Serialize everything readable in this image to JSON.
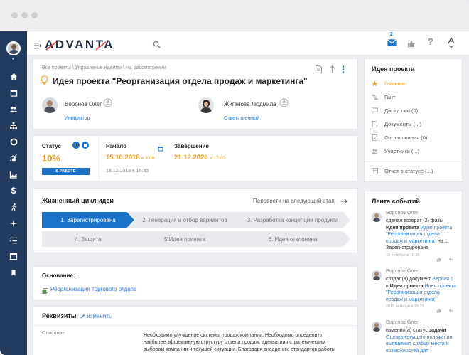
{
  "header": {
    "logo": "ADVANTA",
    "notifications_count": "2"
  },
  "breadcrumb": [
    "Все проекты",
    "Управление идеями",
    "На рассмотрении"
  ],
  "breadcrumb_sep": "\\",
  "page_title": "Идея проекта \"Реорганизация отдела продаж и маркетинга\"",
  "people": [
    {
      "name": "Воронов Олег",
      "role": "Инициатор"
    },
    {
      "name": "Жиганова Людмила",
      "role": "Ответственный"
    }
  ],
  "status": {
    "label": "Статус",
    "percent": "10%",
    "badge": "В РАБОТЕ",
    "start_label": "Начало",
    "start_date": "15.10.2018",
    "start_time": "в 8:00",
    "end_label": "Завершение",
    "end_date": "21.12.2020",
    "end_time": "в 17:00",
    "updated": "18.12.2018 в 15:35"
  },
  "lifecycle": {
    "title": "Жизненный цикл идеи",
    "next_action": "Перевести на следующий этап",
    "stages": [
      "1. Зарегистрирована",
      "2. Генерация и отбор вариантов",
      "3. Разработка концепции продукта",
      "4. Защита",
      "5.Идея принята",
      "6. Идея отклонена"
    ]
  },
  "basis": {
    "label": "Основание:",
    "link": "Реорганизация торгового отдела"
  },
  "requisites": {
    "title": "Реквизиты",
    "edit": "изменить",
    "desc_label": "Описание",
    "desc_lines": [
      "Необходимо улучшение системы продаж компании. Необходимо определить",
      "наиболее эффективную структуру отдела продаж, адекватная стратегическим",
      "выборам компании и текущей ситуации. Благодаря внедрению стандартов работы"
    ]
  },
  "sidebar": {
    "title": "Идея проекта",
    "items": [
      "Главная",
      "Гант",
      "Дискуссии (0)",
      "Документы (...)",
      "Согласования (0)",
      "Участники (...)"
    ],
    "report": "Отчет о статусе (...)"
  },
  "feed": {
    "title": "Лента событий",
    "events": [
      {
        "author": "Воронов Олег",
        "lines": [
          [
            {
              "t": "сделал возврат (2) фазы",
              "s": "n"
            }
          ],
          [
            {
              "t": "Идея проекта ",
              "s": "b"
            },
            {
              "t": "Идея проекта",
              "s": "l"
            }
          ],
          [
            {
              "t": "\"Реорганизация отдела",
              "s": "l"
            }
          ],
          [
            {
              "t": "продаж и маркетинга\"",
              "s": "l"
            },
            {
              "t": " на 1.",
              "s": "n"
            }
          ],
          [
            {
              "t": "Зарегистрирована",
              "s": "n"
            }
          ]
        ],
        "time": "18 октября в 15:35"
      },
      {
        "author": "Воронов Олег",
        "lines": [
          [
            {
              "t": "создал(а) документ ",
              "s": "n"
            },
            {
              "t": "Версия 1",
              "s": "l"
            }
          ],
          [
            {
              "t": "в ",
              "s": "n"
            },
            {
              "t": "Идея проекта ",
              "s": "b"
            },
            {
              "t": "Идея проекта",
              "s": "l"
            }
          ],
          [
            {
              "t": "\"Реорганизация отдела",
              "s": "l"
            }
          ],
          [
            {
              "t": "продаж и маркетинга\"",
              "s": "l"
            }
          ]
        ],
        "time": "2018 октября в 15:35"
      },
      {
        "author": "Воронов Олег",
        "lines": [
          [
            {
              "t": "изменил(а) статус ",
              "s": "n"
            },
            {
              "t": "задачи",
              "s": "b"
            }
          ],
          [
            {
              "t": "Оценка текущего положения,",
              "s": "l"
            }
          ],
          [
            {
              "t": "выявления слабых места и",
              "s": "l"
            }
          ],
          [
            {
              "t": "возможностей для",
              "s": "l"
            }
          ]
        ],
        "time": ""
      }
    ]
  },
  "colors": {
    "nav": "#223a5e",
    "accent": "#1a73c9",
    "orange": "#f39a1e",
    "link": "#2a7bd4"
  }
}
